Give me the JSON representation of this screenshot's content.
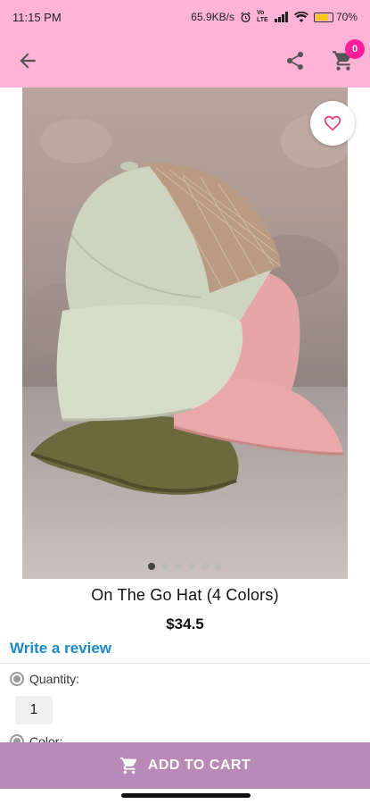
{
  "status_bar": {
    "time": "11:15 PM",
    "network_speed": "65.9KB/s",
    "volte": "Vo LTE",
    "battery": "70"
  },
  "app_bar": {
    "back_icon": "arrow-left-icon",
    "share_icon": "share-icon",
    "cart_icon": "shopping-cart-icon",
    "cart_count": "0"
  },
  "colors": {
    "header_bg": "#ffb3d9",
    "badge": "#ff1f9a",
    "link": "#1e88c8",
    "add_to_cart_bg": "#b98ab8",
    "favorite_icon": "#e8457f"
  },
  "product": {
    "title": "On The Go Hat (4 Colors)",
    "price": "$34.5",
    "write_review": "Write a review",
    "favorite_icon": "heart-outline-icon",
    "carousel": {
      "count": 6,
      "active": 0
    }
  },
  "options": {
    "quantity_label": "Quantity:",
    "quantity_value": "1",
    "color_label": "Color:"
  },
  "add_to_cart": {
    "label": "ADD TO CART",
    "icon": "cart-icon"
  }
}
